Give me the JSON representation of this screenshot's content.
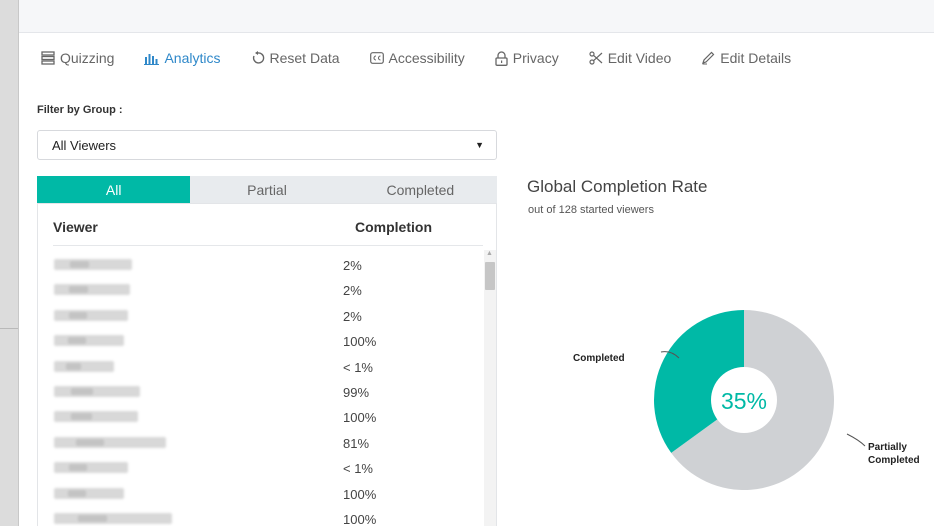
{
  "toolbar": {
    "tabs": [
      {
        "label": "Quizzing",
        "icon": "quizzing-icon"
      },
      {
        "label": "Analytics",
        "icon": "analytics-icon"
      },
      {
        "label": "Reset Data",
        "icon": "reset-icon"
      },
      {
        "label": "Accessibility",
        "icon": "captions-icon"
      },
      {
        "label": "Privacy",
        "icon": "lock-icon"
      },
      {
        "label": "Edit Video",
        "icon": "scissors-icon"
      },
      {
        "label": "Edit Details",
        "icon": "pencil-icon"
      }
    ],
    "active_tab": "Analytics",
    "active_color": "#2f88c9"
  },
  "filter": {
    "label": "Filter by Group :",
    "selected": "All Viewers"
  },
  "segments": {
    "items": [
      "All",
      "Partial",
      "Completed"
    ],
    "active": "All",
    "active_color": "#00b9a6"
  },
  "table": {
    "headers": {
      "viewer": "Viewer",
      "completion": "Completion"
    },
    "rows": [
      {
        "completion": "2%"
      },
      {
        "completion": "2%"
      },
      {
        "completion": "2%"
      },
      {
        "completion": "100%"
      },
      {
        "completion": "< 1%"
      },
      {
        "completion": "99%"
      },
      {
        "completion": "100%"
      },
      {
        "completion": "81%"
      },
      {
        "completion": "< 1%"
      },
      {
        "completion": "100%"
      },
      {
        "completion": "100%"
      }
    ]
  },
  "chart": {
    "title": "Global Completion Rate",
    "subtitle": "out of 128 started viewers",
    "center_label": "35%",
    "completed_label": "Completed",
    "partial_label": "Partially Completed"
  },
  "chart_data": {
    "type": "pie",
    "title": "Global Completion Rate",
    "subtitle": "out of 128 started viewers",
    "categories": [
      "Completed",
      "Partially Completed"
    ],
    "values": [
      35,
      65
    ],
    "colors": [
      "#00b9a6",
      "#cfd1d4"
    ],
    "donut": true,
    "center_label": "35%"
  }
}
